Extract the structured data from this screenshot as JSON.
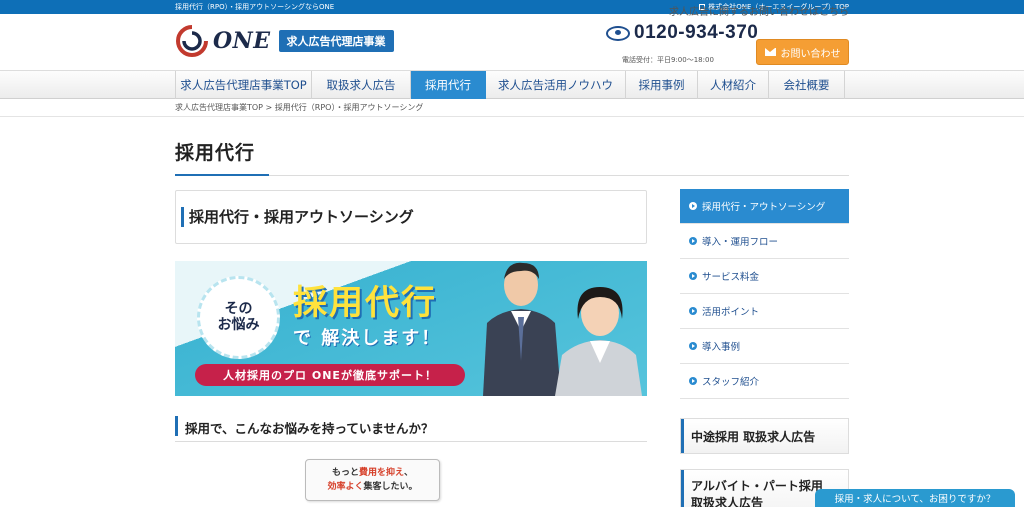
{
  "topbar": {
    "tagline": "採用代行（RPO）・採用アウトソーシングならONE",
    "group_link": "株式会社ONE（オーエヌイーグループ）TOP"
  },
  "header": {
    "logo_text": "ONE",
    "logo_badge": "求人広告代理店事業",
    "contact_note": "求人広告に関するお問い合わせはこちら",
    "phone_number": "0120-934-370",
    "phone_hours": "電話受付：平日9:00〜18:00",
    "contact_button": "お問い合わせ"
  },
  "nav": {
    "items": [
      {
        "label": "求人広告代理店事業TOP",
        "active": false
      },
      {
        "label": "取扱求人広告",
        "active": false
      },
      {
        "label": "採用代行",
        "active": true
      },
      {
        "label": "求人広告活用ノウハウ",
        "active": false
      },
      {
        "label": "採用事例",
        "active": false
      },
      {
        "label": "人材紹介",
        "active": false
      },
      {
        "label": "会社概要",
        "active": false
      }
    ]
  },
  "breadcrumb": "求人広告代理店事業TOP > 採用代行（RPO）・採用アウトソーシング",
  "page_title": "採用代行",
  "main": {
    "section_heading": "採用代行・採用アウトソーシング",
    "banner": {
      "bubble_line1": "その",
      "bubble_line2": "お悩み",
      "headline": "採用代行",
      "subline": "で 解決します！",
      "tag": "人材採用のプロ ONEが徹底サポート！"
    },
    "question_heading": "採用で、こんなお悩みを持っていませんか？",
    "worry_card": {
      "line1_pre": "もっと",
      "line1_hl": "費用を抑え",
      "line1_post": "、",
      "line2_hl": "効率よく",
      "line2_post": "集客したい。"
    }
  },
  "sidebar": {
    "items": [
      {
        "label": "採用代行・アウトソーシング",
        "active": true
      },
      {
        "label": "導入・運用フロー",
        "active": false
      },
      {
        "label": "サービス料金",
        "active": false
      },
      {
        "label": "活用ポイント",
        "active": false
      },
      {
        "label": "導入事例",
        "active": false
      },
      {
        "label": "スタッフ紹介",
        "active": false
      }
    ],
    "box1": "中途採用 取扱求人広告",
    "box2_line1": "アルバイト・パート採用",
    "box2_line2": "取扱求人広告"
  },
  "chat_bar": "採用・求人について、お困りですか？",
  "colors": {
    "brand_blue": "#1f6fb5",
    "nav_active": "#2a8bd0",
    "contact_orange": "#f59e34",
    "banner_tag": "#c6214a",
    "highlight": "#d6402a"
  }
}
